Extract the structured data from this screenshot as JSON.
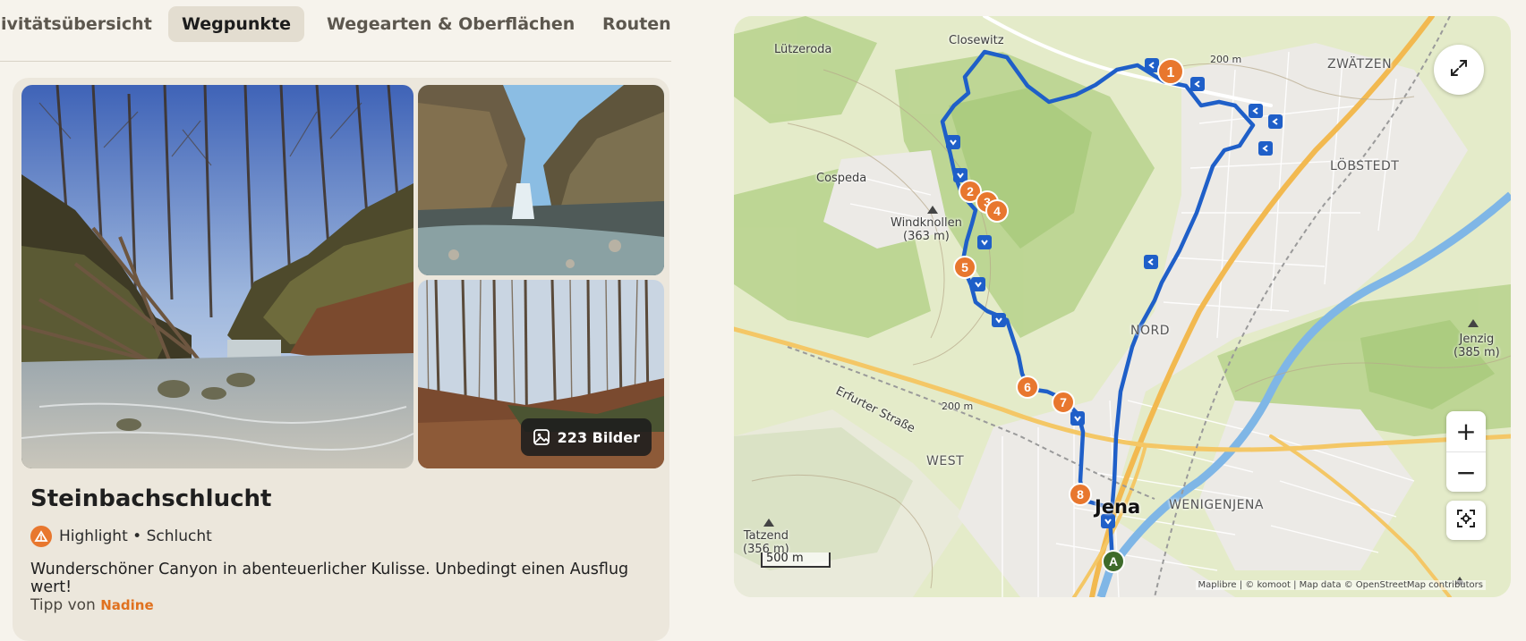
{
  "tabs": [
    {
      "label": "ivitätsübersicht"
    },
    {
      "label": "Wegpunkte",
      "active": true
    },
    {
      "label": "Wegearten & Oberflächen"
    },
    {
      "label": "Routend"
    }
  ],
  "highlight": {
    "image_count_label": "223 Bilder",
    "title": "Steinbachschlucht",
    "category": "Highlight • Schlucht",
    "description": "Wunderschöner Canyon in abenteuerlicher Kulisse. Unbedingt einen Ausflug wert!",
    "tip_prefix": "Tipp von",
    "tip_author": "Nadine"
  },
  "map": {
    "labels": {
      "luetzeroda": "Lützeroda",
      "closewitz": "Closewitz",
      "zwaetzen": "ZWÄTZEN",
      "cospeda": "Cospeda",
      "loebstedt": "LÖBSTEDT",
      "windknollen": "Windknollen",
      "windknollen_height": "(363 m)",
      "nord": "NORD",
      "jenzig": "Jenzig",
      "jenzig_height": "(385 m)",
      "erfurter_strasse": "Erfurter Straße",
      "contour_200_a": "200 m",
      "contour_200_b": "200 m",
      "west": "WEST",
      "jena": "Jena",
      "wenigenjena": "WENIGENJENA",
      "tatzend": "Tatzend",
      "tatzend_height": "(356 m)"
    },
    "waypoints": [
      "1",
      "2",
      "3",
      "4",
      "5",
      "6",
      "7",
      "8"
    ],
    "start_marker": "A",
    "scale_label": "500 m",
    "attribution": "Maplibre | © komoot | Map data © OpenStreetMap contributors",
    "zoom_in_label": "+",
    "zoom_out_label": "−",
    "colors": {
      "route": "#1f5fc8",
      "waypoint": "#e8772e",
      "start": "#3e6b2a"
    }
  }
}
